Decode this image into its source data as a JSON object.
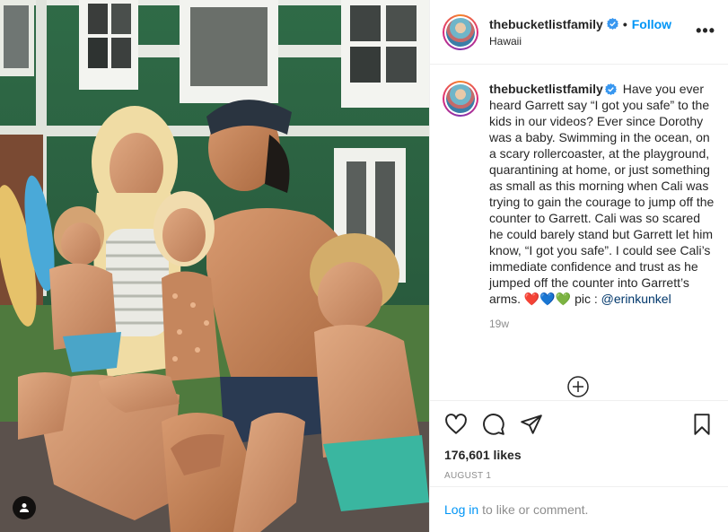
{
  "post": {
    "username": "thebucketlistfamily",
    "follow_label": "Follow",
    "dot": "•",
    "location": "Hawaii",
    "more_label": "•••",
    "caption": "Have you ever heard Garrett say “I got you safe” to the kids in our videos? Ever since Dorothy was a baby. Swimming in the ocean, on a scary rollercoaster, at the playground, quarantining at home, or just something as small as this morning when Cali was trying to gain the courage to jump off the counter to Garrett. Cali was so scared he could barely stand but Garrett let him know, “I got you safe”. I could see Cali’s immediate confidence and trust as he jumped off the counter into Garrett’s arms.",
    "hearts": "❤️💙💚",
    "pic_credit_prefix": "pic :",
    "mention": "@erinkunkel",
    "age": "19w",
    "likes": "176,601 likes",
    "date": "AUGUST 1",
    "login_link": "Log in",
    "login_suffix": "to like or comment."
  },
  "icons": {
    "verified": "verified-badge-icon",
    "more": "more-options-icon",
    "load_more": "plus-circle-icon",
    "like": "heart-icon",
    "comment": "comment-icon",
    "share": "paper-plane-icon",
    "save": "bookmark-icon",
    "tag": "user-tag-icon"
  },
  "colors": {
    "accent": "#0095f6",
    "verified": "#3897f0",
    "muted": "#8e8e8e",
    "text": "#262626"
  }
}
